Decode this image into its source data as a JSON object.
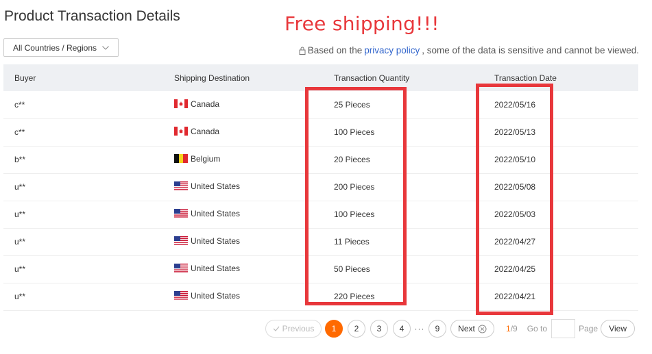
{
  "page": {
    "title": "Product Transaction Details",
    "promo_text": "Free shipping!!!"
  },
  "filter": {
    "country_select_value": "All Countries / Regions"
  },
  "notice": {
    "prefix": "Based on the",
    "link": "privacy policy",
    "suffix": ", some of the data is sensitive and cannot be viewed."
  },
  "table": {
    "columns": [
      "Buyer",
      "Shipping Destination",
      "Transaction Quantity",
      "Transaction Date"
    ],
    "rows": [
      {
        "buyer": "c**",
        "flag": "canada-flag-icon",
        "destination": "Canada",
        "quantity": "25 Pieces",
        "date": "2022/05/16"
      },
      {
        "buyer": "c**",
        "flag": "canada-flag-icon",
        "destination": "Canada",
        "quantity": "100 Pieces",
        "date": "2022/05/13"
      },
      {
        "buyer": "b**",
        "flag": "belgium-flag-icon",
        "destination": "Belgium",
        "quantity": "20 Pieces",
        "date": "2022/05/10"
      },
      {
        "buyer": "u**",
        "flag": "usa-flag-icon",
        "destination": "United States",
        "quantity": "200 Pieces",
        "date": "2022/05/08"
      },
      {
        "buyer": "u**",
        "flag": "usa-flag-icon",
        "destination": "United States",
        "quantity": "100 Pieces",
        "date": "2022/05/03"
      },
      {
        "buyer": "u**",
        "flag": "usa-flag-icon",
        "destination": "United States",
        "quantity": "11 Pieces",
        "date": "2022/04/27"
      },
      {
        "buyer": "u**",
        "flag": "usa-flag-icon",
        "destination": "United States",
        "quantity": "50 Pieces",
        "date": "2022/04/25"
      },
      {
        "buyer": "u**",
        "flag": "usa-flag-icon",
        "destination": "United States",
        "quantity": "220 Pieces",
        "date": "2022/04/21"
      }
    ]
  },
  "pagination": {
    "previous_label": "Previous",
    "pages": [
      "1",
      "2",
      "3",
      "4"
    ],
    "ellipsis": "···",
    "last_page": "9",
    "next_label": "Next",
    "current": "1",
    "total": "/9",
    "goto_label": "Go to",
    "goto_value": "",
    "page_label": "Page",
    "view_label": "View"
  },
  "colors": {
    "accent_orange": "#ff6a00",
    "highlight_red": "#e8373b",
    "link_blue": "#3366cc",
    "header_bg": "#eef0f3"
  }
}
